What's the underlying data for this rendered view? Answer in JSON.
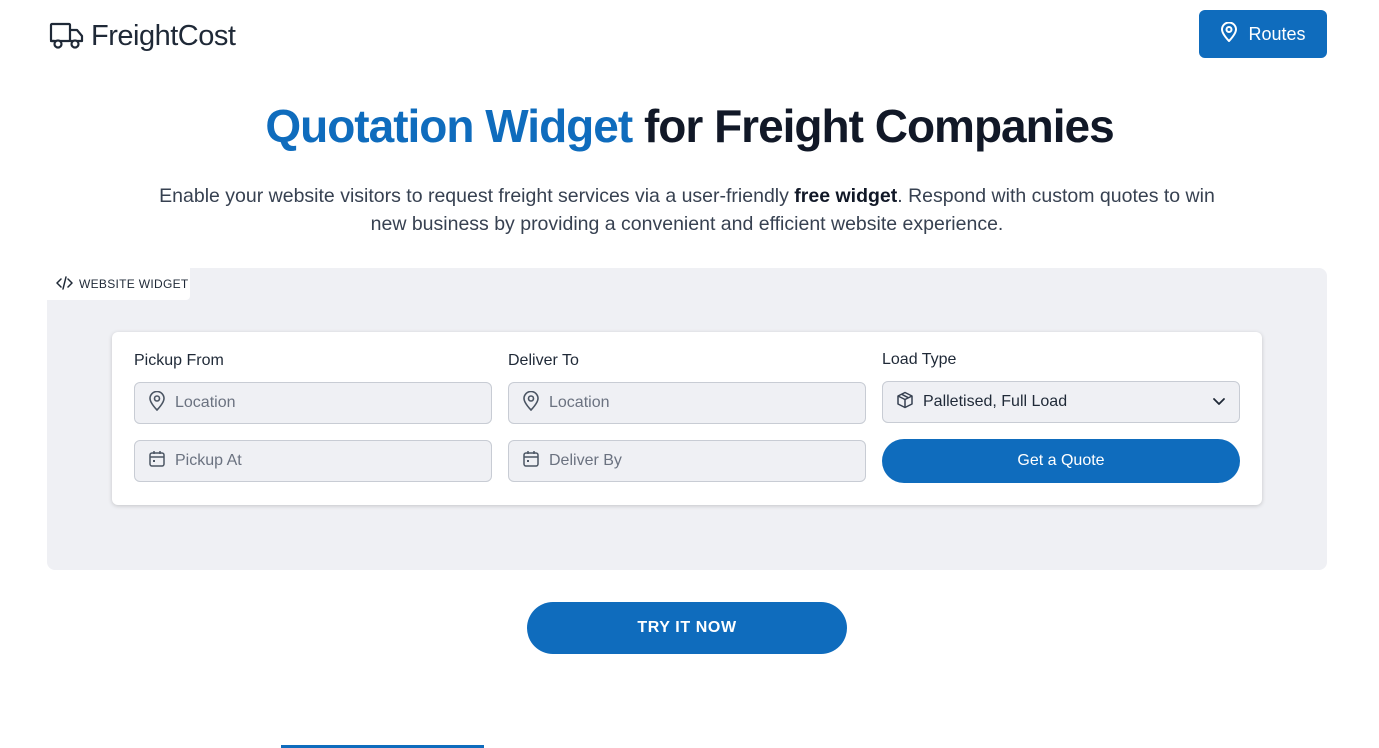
{
  "brand": {
    "name_part1": "Freight",
    "name_part2": "Cost"
  },
  "header": {
    "routes_label": "Routes"
  },
  "hero": {
    "title_accent": "Quotation Widget",
    "title_rest": " for Freight Companies",
    "subtitle_part1": "Enable your website visitors to request freight services via a user-friendly ",
    "subtitle_bold": "free widget",
    "subtitle_part2": ". Respond with custom quotes to win new business by providing a convenient and efficient website experience."
  },
  "demo": {
    "tag_label": "WEBSITE WIDGET",
    "widget": {
      "pickup_label": "Pickup From",
      "pickup_placeholder": "Location",
      "deliver_label": "Deliver To",
      "deliver_placeholder": "Location",
      "load_type_label": "Load Type",
      "load_type_value": "Palletised, Full Load",
      "pickup_at_placeholder": "Pickup At",
      "deliver_by_placeholder": "Deliver By",
      "quote_button": "Get a Quote"
    }
  },
  "cta": {
    "try_label": "TRY IT NOW"
  },
  "colors": {
    "accent": "#0f6cbd",
    "panel": "#eff0f4",
    "text": "#1f2937"
  },
  "icons": [
    "truck-icon",
    "map-pin-icon",
    "code-icon",
    "box-icon",
    "calendar-icon",
    "chevron-down-icon"
  ]
}
